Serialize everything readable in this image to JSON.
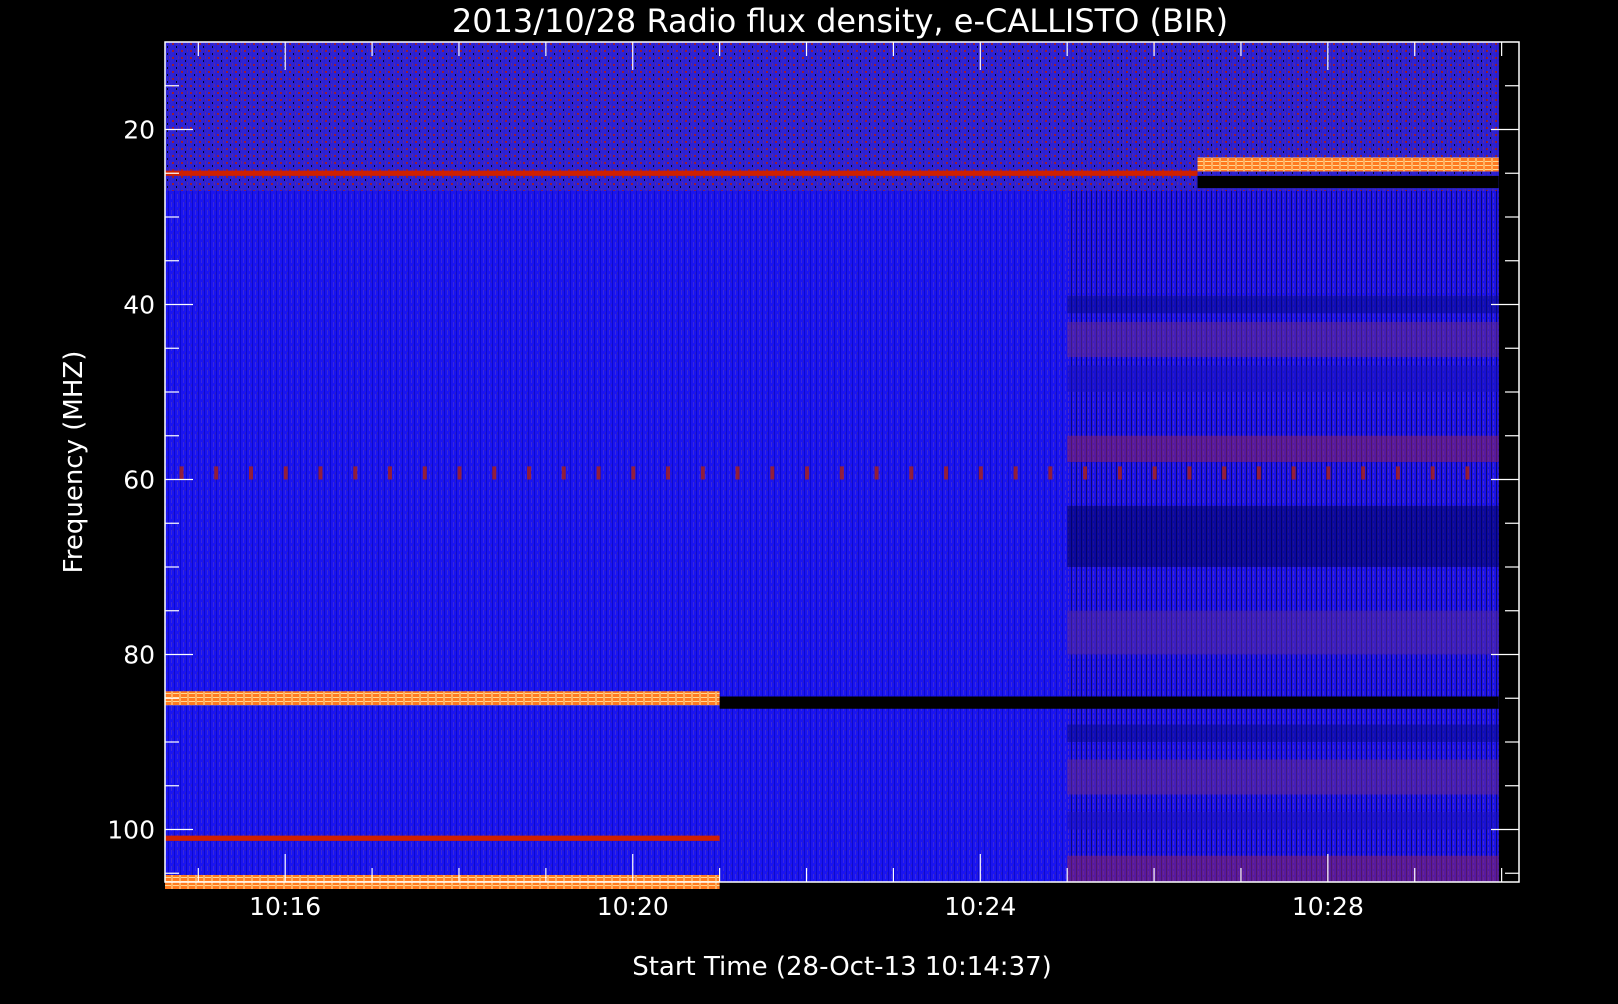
{
  "chart_data": {
    "type": "heatmap",
    "title": "2013/10/28  Radio flux density, e-CALLISTO (BIR)",
    "xlabel": "Start Time (28-Oct-13 10:14:37)",
    "ylabel": "Frequency (MHZ)",
    "x_unit": "UT time",
    "xlim": [
      "10:14:37",
      "10:30:12"
    ],
    "ylim": [
      106,
      10
    ],
    "y_axis_inverted": true,
    "x_ticks": [
      "10:16",
      "10:20",
      "10:24",
      "10:28"
    ],
    "y_ticks": [
      "20",
      "40",
      "60",
      "80",
      "100"
    ],
    "data_extent": {
      "t_start": "10:14:37",
      "t_end": "10:29:58",
      "f_min": 10,
      "f_max": 106
    },
    "colormap": [
      "#000000",
      "#1010ff",
      "#4030e0",
      "#8a2060",
      "#d02000",
      "#ff7a20",
      "#ffd890"
    ],
    "segments": [
      {
        "t_start": "10:14:37",
        "t_end": "10:21:00",
        "note": ""
      },
      {
        "t_start": "10:21:00",
        "t_end": "10:25:00",
        "note": ""
      },
      {
        "t_start": "10:25:00",
        "t_end": "10:29:58",
        "note": ""
      }
    ],
    "features": [
      {
        "label": "",
        "kind": "rfi-band",
        "freq": 85,
        "t_start": "10:14:37",
        "t_end": "10:21:00",
        "intensity": "high"
      },
      {
        "label": "",
        "kind": "rfi-band",
        "freq": 106,
        "t_start": "10:14:37",
        "t_end": "10:21:00",
        "intensity": "high"
      },
      {
        "label": "",
        "kind": "rfi-band",
        "freq": 101,
        "t_start": "10:14:37",
        "t_end": "10:21:00",
        "intensity": "medium"
      },
      {
        "label": "",
        "kind": "rfi-band",
        "freq": 25,
        "t_start": "10:14:37",
        "t_end": "10:26:30",
        "intensity": "medium"
      },
      {
        "label": "",
        "kind": "rfi-band",
        "freq": 24,
        "t_start": "10:26:30",
        "t_end": "10:29:58",
        "intensity": "high"
      },
      {
        "label": "",
        "kind": "dropout",
        "freq": 85.5,
        "t_start": "10:21:00",
        "t_end": "10:29:58",
        "intensity": "none"
      },
      {
        "label": "",
        "kind": "dropout",
        "freq": 26,
        "t_start": "10:26:30",
        "t_end": "10:29:58",
        "intensity": "none"
      }
    ],
    "grid": false,
    "legend": "none"
  }
}
